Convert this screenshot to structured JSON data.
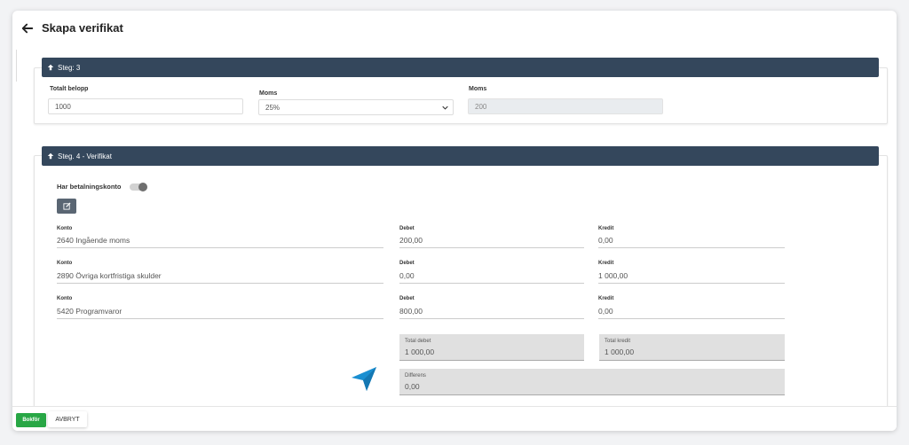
{
  "page": {
    "title": "Skapa verifikat"
  },
  "step3": {
    "header": "Steg: 3",
    "total_label": "Totalt belopp",
    "total_value": "1000",
    "moms_select_label": "Moms",
    "moms_select_value": "25%",
    "moms_label": "Moms",
    "moms_value": "200"
  },
  "step4": {
    "header": "Steg. 4 - Verifikat",
    "payment_toggle_label": "Har betalningskonto",
    "rows": [
      {
        "konto_label": "Konto",
        "konto": "2640 Ingående moms",
        "debet_label": "Debet",
        "debet": "200,00",
        "kredit_label": "Kredit",
        "kredit": "0,00"
      },
      {
        "konto_label": "Konto",
        "konto": "2890 Övriga kortfristiga skulder",
        "debet_label": "Debet",
        "debet": "0,00",
        "kredit_label": "Kredit",
        "kredit": "1 000,00"
      },
      {
        "konto_label": "Konto",
        "konto": "5420 Programvaror",
        "debet_label": "Debet",
        "debet": "800,00",
        "kredit_label": "Kredit",
        "kredit": "0,00"
      }
    ],
    "total_debet_label": "Total debet",
    "total_debet": "1 000,00",
    "total_kredit_label": "Total kredit",
    "total_kredit": "1 000,00",
    "differens_label": "Differens",
    "differens": "0,00"
  },
  "footer": {
    "book_label": "Bokför",
    "cancel_label": "AVBRYT"
  },
  "colors": {
    "section_header": "#34475c",
    "primary_green": "#28a745",
    "cursor": "#1a8fd1"
  }
}
